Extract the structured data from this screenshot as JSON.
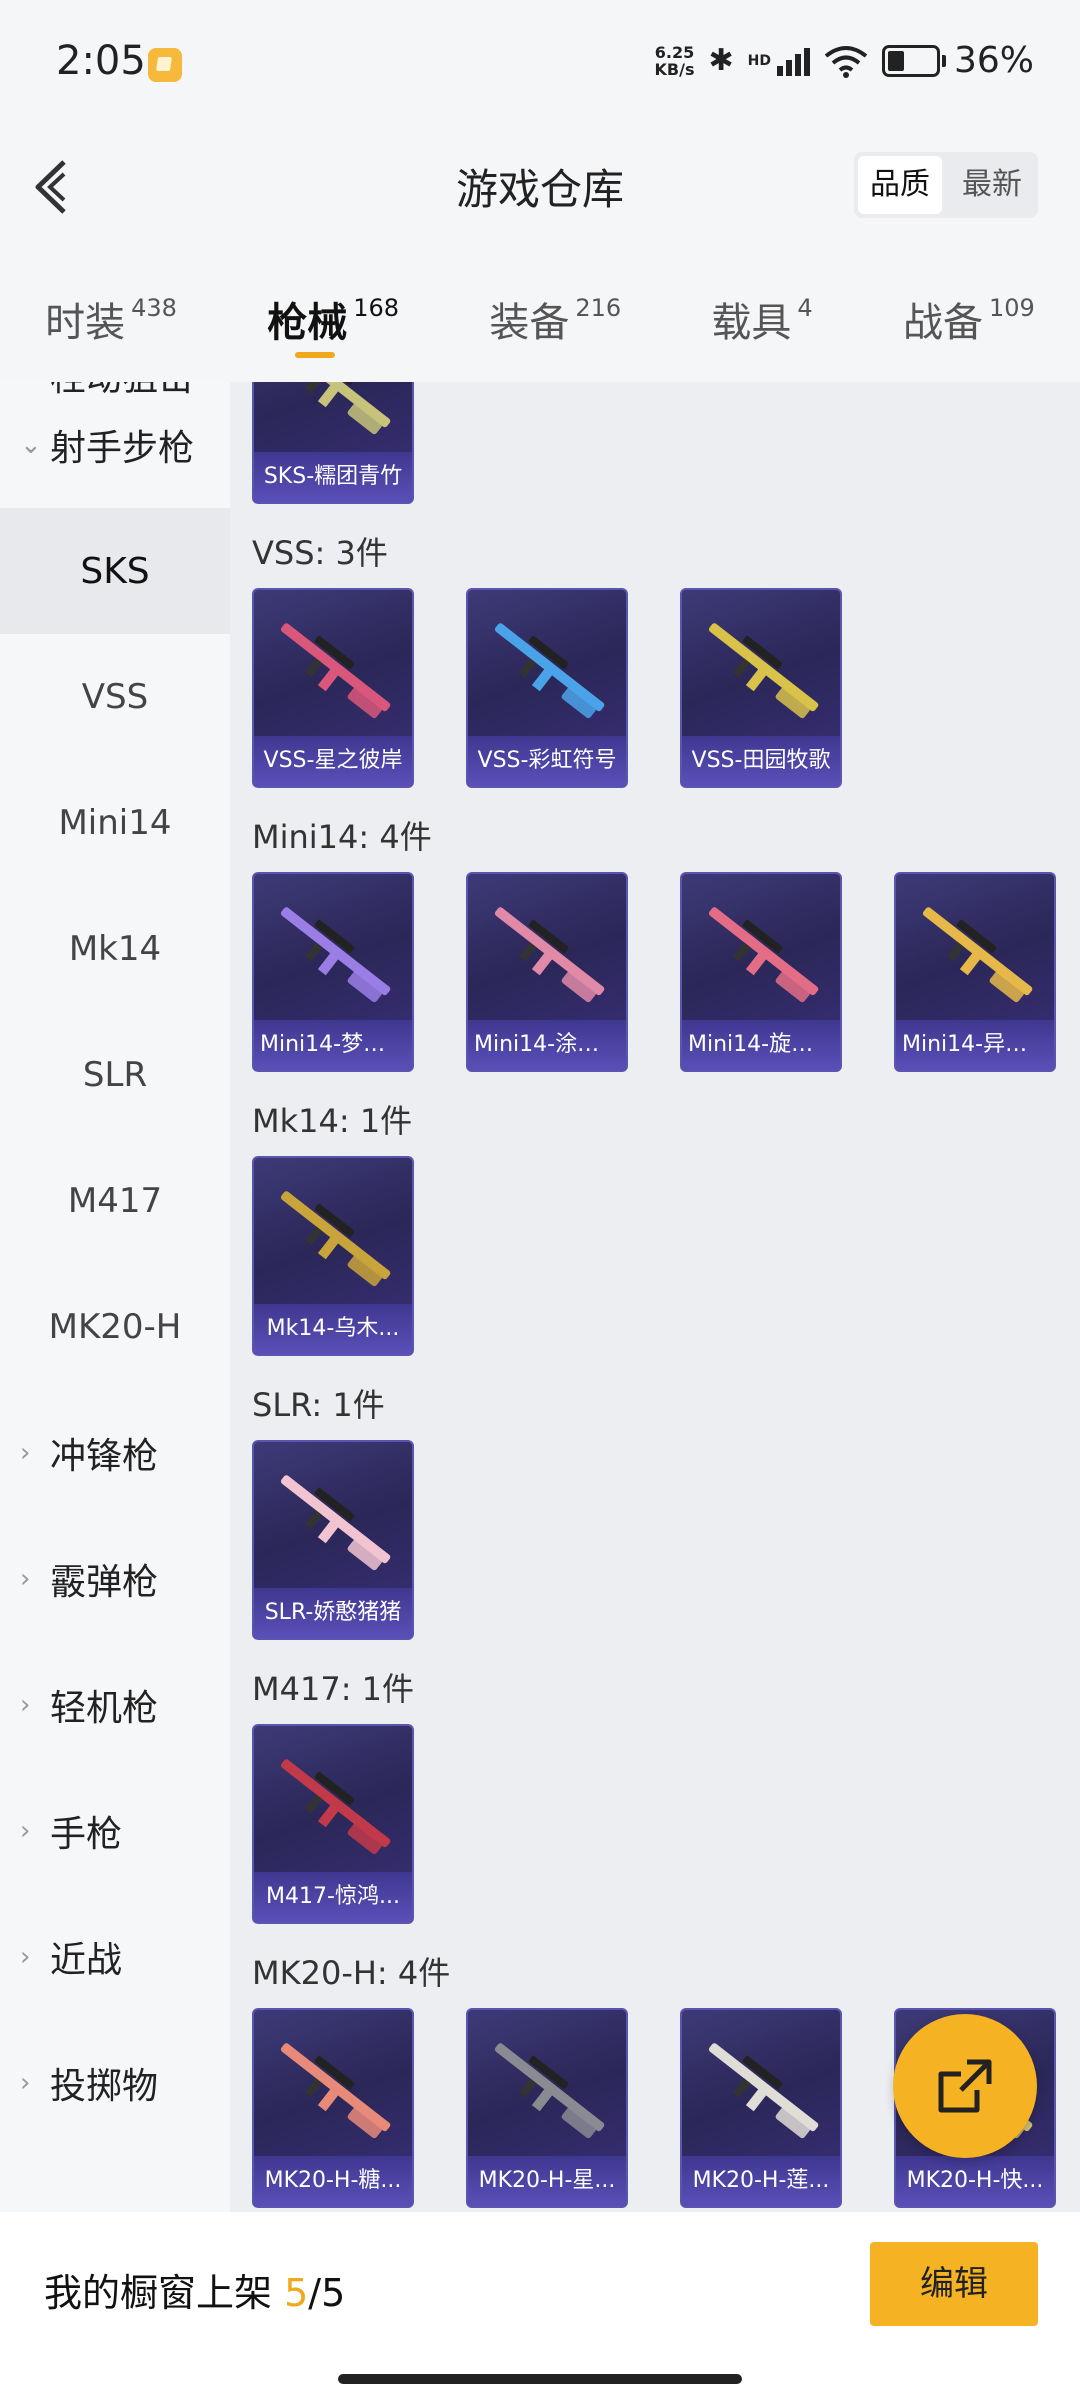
{
  "status_bar": {
    "time": "2:05",
    "net_speed_value": "6.25",
    "net_speed_unit": "KB/s",
    "signal_label": "HD",
    "battery_percent": "36%"
  },
  "header": {
    "title": "游戏仓库",
    "sort_options": [
      "品质",
      "最新"
    ],
    "sort_active": "品质"
  },
  "tabs": [
    {
      "label": "时装",
      "count": "438"
    },
    {
      "label": "枪械",
      "count": "168",
      "active": true
    },
    {
      "label": "装备",
      "count": "216"
    },
    {
      "label": "载具",
      "count": "4"
    },
    {
      "label": "战备",
      "count": "109"
    }
  ],
  "sidebar": {
    "items": [
      {
        "label": "栓动狙击",
        "type": "category",
        "expanded": false
      },
      {
        "label": "射手步枪",
        "type": "category",
        "expanded": true
      },
      {
        "label": "SKS",
        "type": "sub",
        "selected": true
      },
      {
        "label": "VSS",
        "type": "sub"
      },
      {
        "label": "Mini14",
        "type": "sub"
      },
      {
        "label": "Mk14",
        "type": "sub"
      },
      {
        "label": "SLR",
        "type": "sub"
      },
      {
        "label": "M417",
        "type": "sub"
      },
      {
        "label": "MK20-H",
        "type": "sub"
      },
      {
        "label": "冲锋枪",
        "type": "category",
        "expanded": false
      },
      {
        "label": "霰弹枪",
        "type": "category",
        "expanded": false
      },
      {
        "label": "轻机枪",
        "type": "category",
        "expanded": false
      },
      {
        "label": "手枪",
        "type": "category",
        "expanded": false
      },
      {
        "label": "近战",
        "type": "category",
        "expanded": false
      },
      {
        "label": "投掷物",
        "type": "category",
        "expanded": false
      }
    ]
  },
  "sections": [
    {
      "title": "",
      "items": [
        {
          "label": "SKS-糯团青竹",
          "color": "#c7c37a"
        }
      ]
    },
    {
      "title": "VSS: 3件",
      "items": [
        {
          "label": "VSS-星之彼岸",
          "color": "#d9577a"
        },
        {
          "label": "VSS-彩虹符号",
          "color": "#4aa3e8"
        },
        {
          "label": "VSS-田园牧歌",
          "color": "#d8c24a"
        }
      ]
    },
    {
      "title": "Mini14: 4件",
      "items": [
        {
          "label": "Mini14-梦幻...",
          "color": "#9a7ee6"
        },
        {
          "label": "Mini14-涂山...",
          "color": "#e08aa8"
        },
        {
          "label": "Mini14-旋转...",
          "color": "#e36d86"
        },
        {
          "label": "Mini14-异彩...",
          "color": "#e6b84a"
        }
      ]
    },
    {
      "title": "Mk14: 1件",
      "items": [
        {
          "label": "Mk14-乌木...",
          "color": "#c9a43a"
        }
      ]
    },
    {
      "title": "SLR: 1件",
      "items": [
        {
          "label": "SLR-娇憨猪猪",
          "color": "#f2c4d2"
        }
      ]
    },
    {
      "title": "M417: 1件",
      "items": [
        {
          "label": "M417-惊鸿...",
          "color": "#c23a4a"
        }
      ]
    },
    {
      "title": "MK20-H: 4件",
      "items": [
        {
          "label": "MK20-H-糖...",
          "color": "#e88a7a"
        },
        {
          "label": "MK20-H-星...",
          "color": "#8a8a92"
        },
        {
          "label": "MK20-H-莲...",
          "color": "#e0dcd6"
        },
        {
          "label": "MK20-H-快...",
          "color": "#d0c070"
        }
      ]
    }
  ],
  "bottom_bar": {
    "label_prefix": "我的橱窗上架 ",
    "current": "5",
    "total": "/5",
    "edit_label": "编辑"
  },
  "accent_color": "#f2a81d"
}
